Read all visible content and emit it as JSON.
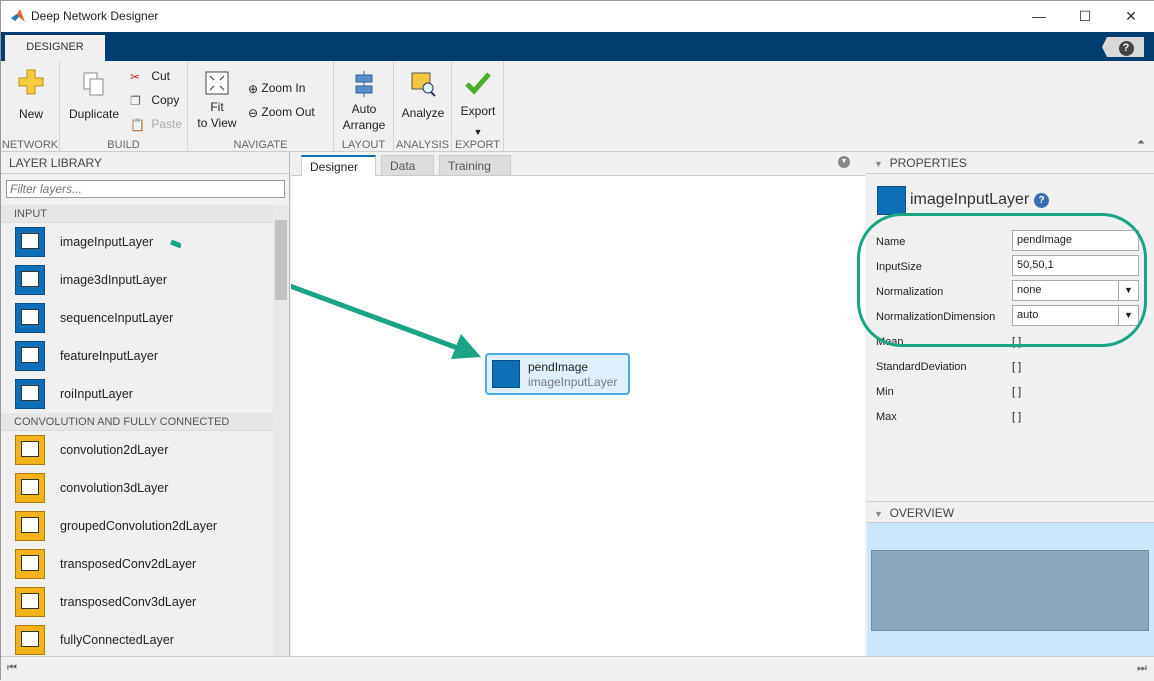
{
  "window": {
    "title": "Deep Network Designer",
    "minimize": "—",
    "maximize": "☐",
    "close": "✕"
  },
  "ribbon": {
    "tab": "DESIGNER",
    "help": "?",
    "new": "New",
    "duplicate": "Duplicate",
    "cut": "Cut",
    "copy": "Copy",
    "paste": "Paste",
    "fit_line1": "Fit",
    "fit_line2": "to View",
    "zoom_in": "Zoom In",
    "zoom_out": "Zoom Out",
    "auto_line1": "Auto",
    "auto_line2": "Arrange",
    "analyze": "Analyze",
    "export": "Export",
    "sections": [
      "NETWORK",
      "BUILD",
      "NAVIGATE",
      "LAYOUT",
      "ANALYSIS",
      "EXPORT"
    ]
  },
  "library": {
    "header": "LAYER LIBRARY",
    "filter_placeholder": "Filter layers...",
    "groups": [
      {
        "label": "INPUT",
        "items": [
          "imageInputLayer",
          "image3dInputLayer",
          "sequenceInputLayer",
          "featureInputLayer",
          "roiInputLayer"
        ]
      },
      {
        "label": "CONVOLUTION AND FULLY CONNECTED",
        "items": [
          "convolution2dLayer",
          "convolution3dLayer",
          "groupedConvolution2dLayer",
          "transposedConv2dLayer",
          "transposedConv3dLayer",
          "fullyConnectedLayer"
        ]
      }
    ]
  },
  "canvas": {
    "tabs": [
      "Designer",
      "Data",
      "Training"
    ],
    "node": {
      "name": "pendImage",
      "type": "imageInputLayer"
    },
    "annotation_color": "#1aa385"
  },
  "properties": {
    "header": "PROPERTIES",
    "layer_type": "imageInputLayer",
    "help": "?",
    "rows": [
      {
        "label": "Name",
        "value": "pendImage",
        "kind": "text"
      },
      {
        "label": "InputSize",
        "value": "50,50,1",
        "kind": "text"
      },
      {
        "label": "Normalization",
        "value": "none",
        "kind": "dropdown"
      },
      {
        "label": "NormalizationDimension",
        "value": "auto",
        "kind": "dropdown"
      },
      {
        "label": "Mean",
        "value": "[ ]",
        "kind": "static"
      },
      {
        "label": "StandardDeviation",
        "value": "[ ]",
        "kind": "static"
      },
      {
        "label": "Min",
        "value": "[ ]",
        "kind": "static"
      },
      {
        "label": "Max",
        "value": "[ ]",
        "kind": "static"
      }
    ]
  },
  "overview": {
    "header": "OVERVIEW"
  }
}
